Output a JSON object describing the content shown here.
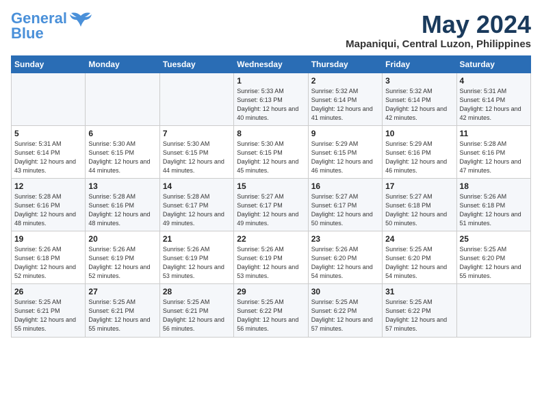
{
  "logo": {
    "line1": "General",
    "line2": "Blue"
  },
  "title": "May 2024",
  "location": "Mapaniqui, Central Luzon, Philippines",
  "weekdays": [
    "Sunday",
    "Monday",
    "Tuesday",
    "Wednesday",
    "Thursday",
    "Friday",
    "Saturday"
  ],
  "weeks": [
    [
      {
        "day": "",
        "sunrise": "",
        "sunset": "",
        "daylight": ""
      },
      {
        "day": "",
        "sunrise": "",
        "sunset": "",
        "daylight": ""
      },
      {
        "day": "",
        "sunrise": "",
        "sunset": "",
        "daylight": ""
      },
      {
        "day": "1",
        "sunrise": "Sunrise: 5:33 AM",
        "sunset": "Sunset: 6:13 PM",
        "daylight": "Daylight: 12 hours and 40 minutes."
      },
      {
        "day": "2",
        "sunrise": "Sunrise: 5:32 AM",
        "sunset": "Sunset: 6:14 PM",
        "daylight": "Daylight: 12 hours and 41 minutes."
      },
      {
        "day": "3",
        "sunrise": "Sunrise: 5:32 AM",
        "sunset": "Sunset: 6:14 PM",
        "daylight": "Daylight: 12 hours and 42 minutes."
      },
      {
        "day": "4",
        "sunrise": "Sunrise: 5:31 AM",
        "sunset": "Sunset: 6:14 PM",
        "daylight": "Daylight: 12 hours and 42 minutes."
      }
    ],
    [
      {
        "day": "5",
        "sunrise": "Sunrise: 5:31 AM",
        "sunset": "Sunset: 6:14 PM",
        "daylight": "Daylight: 12 hours and 43 minutes."
      },
      {
        "day": "6",
        "sunrise": "Sunrise: 5:30 AM",
        "sunset": "Sunset: 6:15 PM",
        "daylight": "Daylight: 12 hours and 44 minutes."
      },
      {
        "day": "7",
        "sunrise": "Sunrise: 5:30 AM",
        "sunset": "Sunset: 6:15 PM",
        "daylight": "Daylight: 12 hours and 44 minutes."
      },
      {
        "day": "8",
        "sunrise": "Sunrise: 5:30 AM",
        "sunset": "Sunset: 6:15 PM",
        "daylight": "Daylight: 12 hours and 45 minutes."
      },
      {
        "day": "9",
        "sunrise": "Sunrise: 5:29 AM",
        "sunset": "Sunset: 6:15 PM",
        "daylight": "Daylight: 12 hours and 46 minutes."
      },
      {
        "day": "10",
        "sunrise": "Sunrise: 5:29 AM",
        "sunset": "Sunset: 6:16 PM",
        "daylight": "Daylight: 12 hours and 46 minutes."
      },
      {
        "day": "11",
        "sunrise": "Sunrise: 5:28 AM",
        "sunset": "Sunset: 6:16 PM",
        "daylight": "Daylight: 12 hours and 47 minutes."
      }
    ],
    [
      {
        "day": "12",
        "sunrise": "Sunrise: 5:28 AM",
        "sunset": "Sunset: 6:16 PM",
        "daylight": "Daylight: 12 hours and 48 minutes."
      },
      {
        "day": "13",
        "sunrise": "Sunrise: 5:28 AM",
        "sunset": "Sunset: 6:16 PM",
        "daylight": "Daylight: 12 hours and 48 minutes."
      },
      {
        "day": "14",
        "sunrise": "Sunrise: 5:28 AM",
        "sunset": "Sunset: 6:17 PM",
        "daylight": "Daylight: 12 hours and 49 minutes."
      },
      {
        "day": "15",
        "sunrise": "Sunrise: 5:27 AM",
        "sunset": "Sunset: 6:17 PM",
        "daylight": "Daylight: 12 hours and 49 minutes."
      },
      {
        "day": "16",
        "sunrise": "Sunrise: 5:27 AM",
        "sunset": "Sunset: 6:17 PM",
        "daylight": "Daylight: 12 hours and 50 minutes."
      },
      {
        "day": "17",
        "sunrise": "Sunrise: 5:27 AM",
        "sunset": "Sunset: 6:18 PM",
        "daylight": "Daylight: 12 hours and 50 minutes."
      },
      {
        "day": "18",
        "sunrise": "Sunrise: 5:26 AM",
        "sunset": "Sunset: 6:18 PM",
        "daylight": "Daylight: 12 hours and 51 minutes."
      }
    ],
    [
      {
        "day": "19",
        "sunrise": "Sunrise: 5:26 AM",
        "sunset": "Sunset: 6:18 PM",
        "daylight": "Daylight: 12 hours and 52 minutes."
      },
      {
        "day": "20",
        "sunrise": "Sunrise: 5:26 AM",
        "sunset": "Sunset: 6:19 PM",
        "daylight": "Daylight: 12 hours and 52 minutes."
      },
      {
        "day": "21",
        "sunrise": "Sunrise: 5:26 AM",
        "sunset": "Sunset: 6:19 PM",
        "daylight": "Daylight: 12 hours and 53 minutes."
      },
      {
        "day": "22",
        "sunrise": "Sunrise: 5:26 AM",
        "sunset": "Sunset: 6:19 PM",
        "daylight": "Daylight: 12 hours and 53 minutes."
      },
      {
        "day": "23",
        "sunrise": "Sunrise: 5:26 AM",
        "sunset": "Sunset: 6:20 PM",
        "daylight": "Daylight: 12 hours and 54 minutes."
      },
      {
        "day": "24",
        "sunrise": "Sunrise: 5:25 AM",
        "sunset": "Sunset: 6:20 PM",
        "daylight": "Daylight: 12 hours and 54 minutes."
      },
      {
        "day": "25",
        "sunrise": "Sunrise: 5:25 AM",
        "sunset": "Sunset: 6:20 PM",
        "daylight": "Daylight: 12 hours and 55 minutes."
      }
    ],
    [
      {
        "day": "26",
        "sunrise": "Sunrise: 5:25 AM",
        "sunset": "Sunset: 6:21 PM",
        "daylight": "Daylight: 12 hours and 55 minutes."
      },
      {
        "day": "27",
        "sunrise": "Sunrise: 5:25 AM",
        "sunset": "Sunset: 6:21 PM",
        "daylight": "Daylight: 12 hours and 55 minutes."
      },
      {
        "day": "28",
        "sunrise": "Sunrise: 5:25 AM",
        "sunset": "Sunset: 6:21 PM",
        "daylight": "Daylight: 12 hours and 56 minutes."
      },
      {
        "day": "29",
        "sunrise": "Sunrise: 5:25 AM",
        "sunset": "Sunset: 6:22 PM",
        "daylight": "Daylight: 12 hours and 56 minutes."
      },
      {
        "day": "30",
        "sunrise": "Sunrise: 5:25 AM",
        "sunset": "Sunset: 6:22 PM",
        "daylight": "Daylight: 12 hours and 57 minutes."
      },
      {
        "day": "31",
        "sunrise": "Sunrise: 5:25 AM",
        "sunset": "Sunset: 6:22 PM",
        "daylight": "Daylight: 12 hours and 57 minutes."
      },
      {
        "day": "",
        "sunrise": "",
        "sunset": "",
        "daylight": ""
      }
    ]
  ]
}
